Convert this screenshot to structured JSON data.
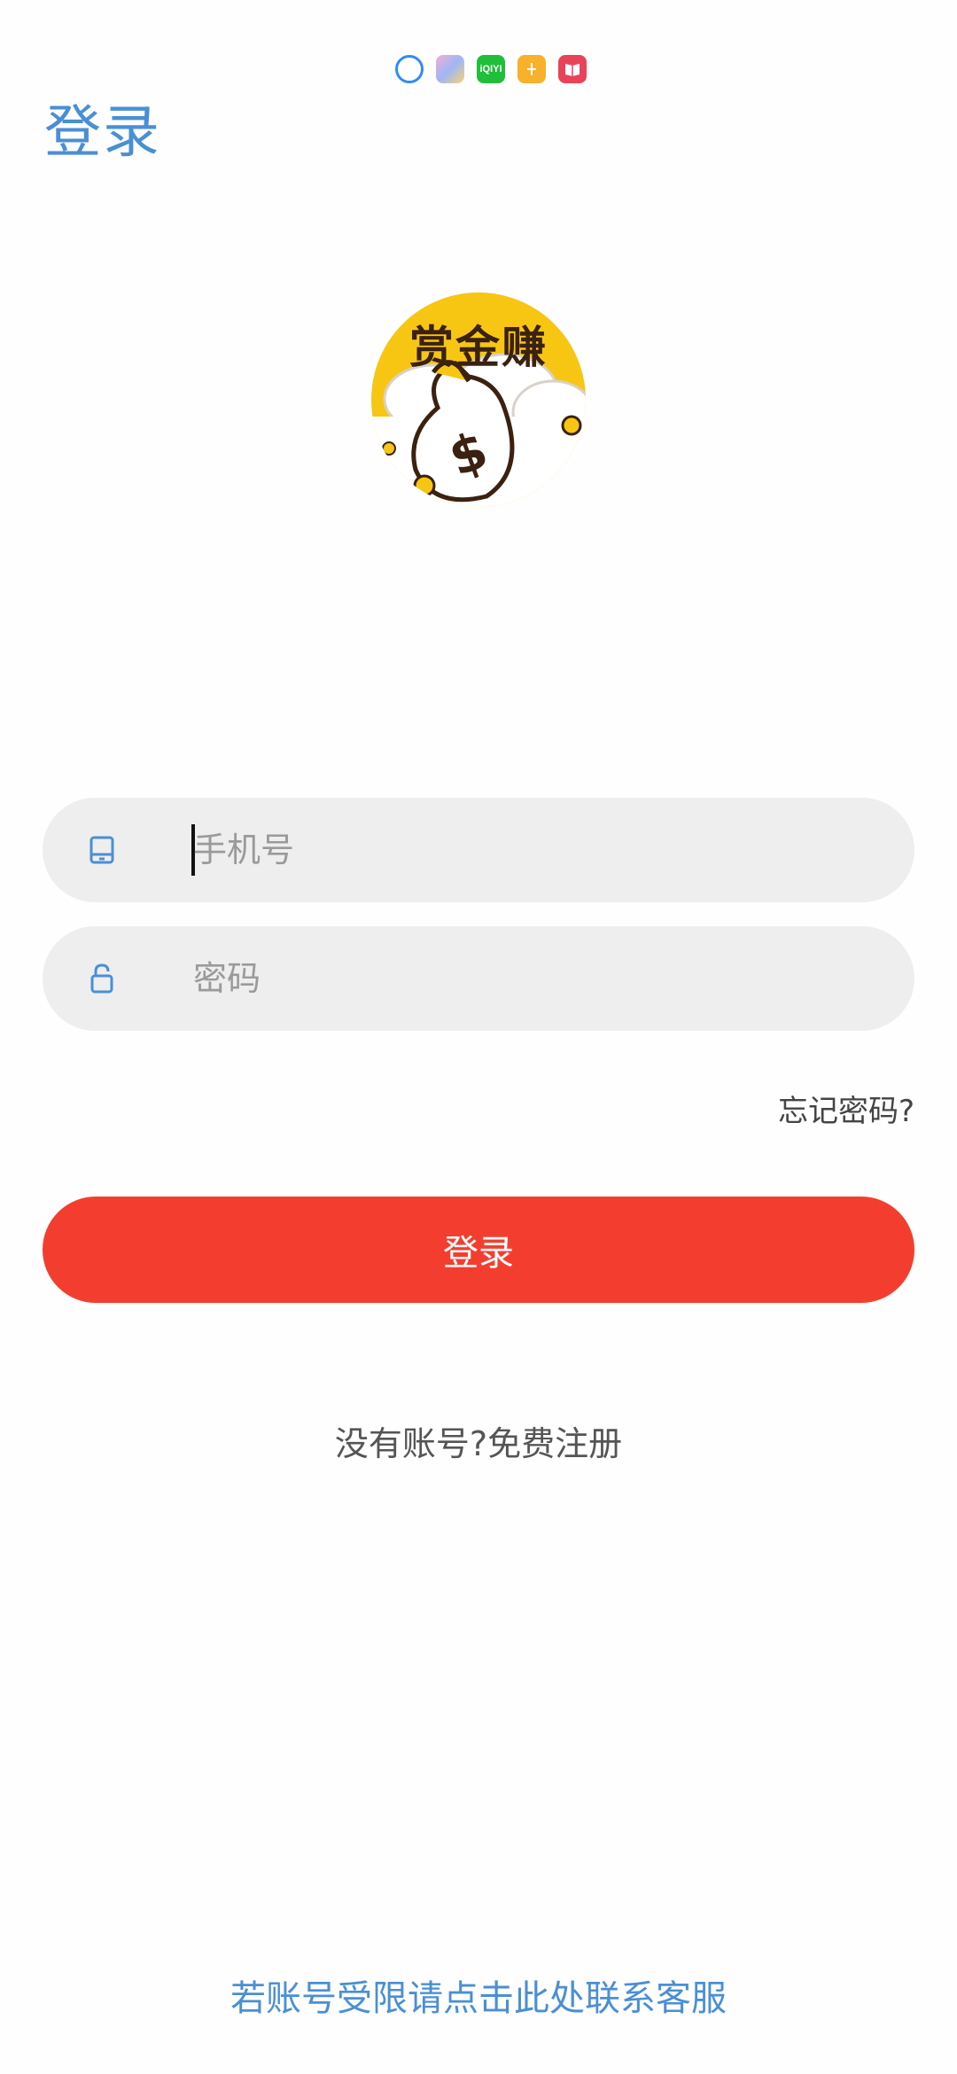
{
  "header": {
    "title": "登录"
  },
  "status_bar": {
    "icons": [
      "browser-icon",
      "gallery-icon",
      "iqiyi-icon",
      "app-icon",
      "book-icon"
    ],
    "iqiyi_text": "iQIYI"
  },
  "logo": {
    "text": "赏金赚",
    "colors": {
      "background": "#f7c613",
      "text": "#3a2110"
    }
  },
  "form": {
    "phone": {
      "placeholder": "手机号",
      "value": ""
    },
    "password": {
      "placeholder": "密码",
      "value": ""
    },
    "forgot_label": "忘记密码?",
    "login_label": "登录",
    "register_label": "没有账号?免费注册"
  },
  "footer": {
    "contact_label": "若账号受限请点击此处联系客服"
  },
  "colors": {
    "accent": "#4a8fd4",
    "primary_button": "#f33e2f",
    "input_bg": "#eeeeef"
  }
}
